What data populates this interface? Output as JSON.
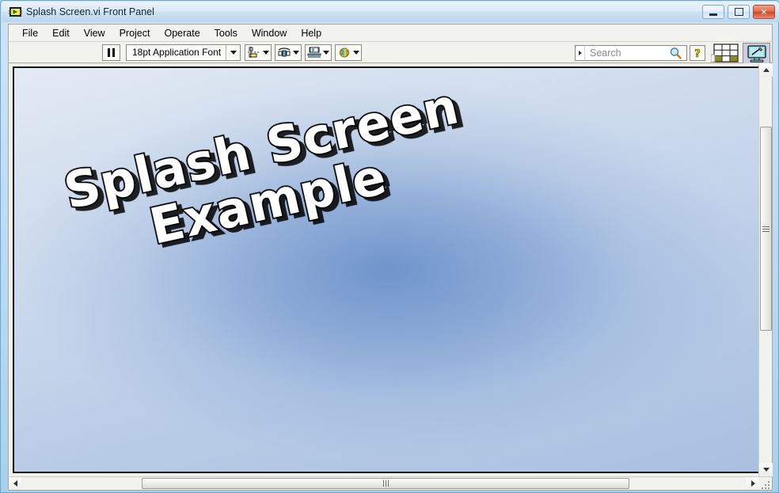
{
  "window": {
    "title": "Splash Screen.vi Front Panel",
    "icon": "labview-vi-icon",
    "controls": {
      "minimize": "Minimize",
      "maximize": "Maximize",
      "close": "Close",
      "close_glyph": "✕"
    }
  },
  "menubar": {
    "items": [
      {
        "label": "File"
      },
      {
        "label": "Edit"
      },
      {
        "label": "View"
      },
      {
        "label": "Project"
      },
      {
        "label": "Operate"
      },
      {
        "label": "Tools"
      },
      {
        "label": "Window"
      },
      {
        "label": "Help"
      }
    ]
  },
  "toolbar": {
    "pause_button": "Pause",
    "font_selector": {
      "value": "18pt Application Font",
      "icon": "chevron-down-icon"
    },
    "align_objects": "Align Objects",
    "distribute_objects": "Distribute Objects",
    "resize_objects": "Resize Objects",
    "reorder_objects": "Reorder",
    "search": {
      "placeholder": "Search",
      "value": "",
      "icon": "magnifier-icon"
    },
    "context_help": "?",
    "grid_palette": "Controls Palette",
    "edit_mode": "Edit Mode"
  },
  "canvas": {
    "splash": {
      "line1": "Splash Screen",
      "line2": "Example"
    },
    "background": {
      "edge_color": "#dce4ef",
      "center_color": "#4a78ba"
    }
  },
  "scrollbars": {
    "vertical": {
      "up": "Scroll Up",
      "down": "Scroll Down",
      "thumb": "Vertical Scroll Thumb"
    },
    "horizontal": {
      "left": "Scroll Left",
      "right": "Scroll Right",
      "thumb": "Horizontal Scroll Thumb"
    }
  },
  "colors": {
    "frame": "#b9d7ef",
    "toolbar_bg": "#f2f2ee",
    "accent": "#6ba6d0"
  }
}
